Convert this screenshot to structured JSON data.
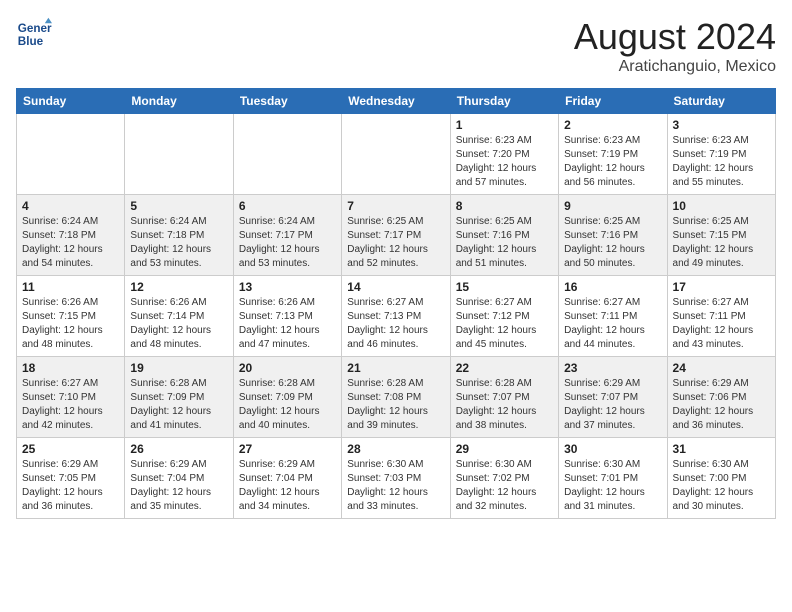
{
  "header": {
    "logo_line1": "General",
    "logo_line2": "Blue",
    "month_year": "August 2024",
    "location": "Aratichanguio, Mexico"
  },
  "weekdays": [
    "Sunday",
    "Monday",
    "Tuesday",
    "Wednesday",
    "Thursday",
    "Friday",
    "Saturday"
  ],
  "weeks": [
    [
      {
        "day": "",
        "info": ""
      },
      {
        "day": "",
        "info": ""
      },
      {
        "day": "",
        "info": ""
      },
      {
        "day": "",
        "info": ""
      },
      {
        "day": "1",
        "info": "Sunrise: 6:23 AM\nSunset: 7:20 PM\nDaylight: 12 hours\nand 57 minutes."
      },
      {
        "day": "2",
        "info": "Sunrise: 6:23 AM\nSunset: 7:19 PM\nDaylight: 12 hours\nand 56 minutes."
      },
      {
        "day": "3",
        "info": "Sunrise: 6:23 AM\nSunset: 7:19 PM\nDaylight: 12 hours\nand 55 minutes."
      }
    ],
    [
      {
        "day": "4",
        "info": "Sunrise: 6:24 AM\nSunset: 7:18 PM\nDaylight: 12 hours\nand 54 minutes."
      },
      {
        "day": "5",
        "info": "Sunrise: 6:24 AM\nSunset: 7:18 PM\nDaylight: 12 hours\nand 53 minutes."
      },
      {
        "day": "6",
        "info": "Sunrise: 6:24 AM\nSunset: 7:17 PM\nDaylight: 12 hours\nand 53 minutes."
      },
      {
        "day": "7",
        "info": "Sunrise: 6:25 AM\nSunset: 7:17 PM\nDaylight: 12 hours\nand 52 minutes."
      },
      {
        "day": "8",
        "info": "Sunrise: 6:25 AM\nSunset: 7:16 PM\nDaylight: 12 hours\nand 51 minutes."
      },
      {
        "day": "9",
        "info": "Sunrise: 6:25 AM\nSunset: 7:16 PM\nDaylight: 12 hours\nand 50 minutes."
      },
      {
        "day": "10",
        "info": "Sunrise: 6:25 AM\nSunset: 7:15 PM\nDaylight: 12 hours\nand 49 minutes."
      }
    ],
    [
      {
        "day": "11",
        "info": "Sunrise: 6:26 AM\nSunset: 7:15 PM\nDaylight: 12 hours\nand 48 minutes."
      },
      {
        "day": "12",
        "info": "Sunrise: 6:26 AM\nSunset: 7:14 PM\nDaylight: 12 hours\nand 48 minutes."
      },
      {
        "day": "13",
        "info": "Sunrise: 6:26 AM\nSunset: 7:13 PM\nDaylight: 12 hours\nand 47 minutes."
      },
      {
        "day": "14",
        "info": "Sunrise: 6:27 AM\nSunset: 7:13 PM\nDaylight: 12 hours\nand 46 minutes."
      },
      {
        "day": "15",
        "info": "Sunrise: 6:27 AM\nSunset: 7:12 PM\nDaylight: 12 hours\nand 45 minutes."
      },
      {
        "day": "16",
        "info": "Sunrise: 6:27 AM\nSunset: 7:11 PM\nDaylight: 12 hours\nand 44 minutes."
      },
      {
        "day": "17",
        "info": "Sunrise: 6:27 AM\nSunset: 7:11 PM\nDaylight: 12 hours\nand 43 minutes."
      }
    ],
    [
      {
        "day": "18",
        "info": "Sunrise: 6:27 AM\nSunset: 7:10 PM\nDaylight: 12 hours\nand 42 minutes."
      },
      {
        "day": "19",
        "info": "Sunrise: 6:28 AM\nSunset: 7:09 PM\nDaylight: 12 hours\nand 41 minutes."
      },
      {
        "day": "20",
        "info": "Sunrise: 6:28 AM\nSunset: 7:09 PM\nDaylight: 12 hours\nand 40 minutes."
      },
      {
        "day": "21",
        "info": "Sunrise: 6:28 AM\nSunset: 7:08 PM\nDaylight: 12 hours\nand 39 minutes."
      },
      {
        "day": "22",
        "info": "Sunrise: 6:28 AM\nSunset: 7:07 PM\nDaylight: 12 hours\nand 38 minutes."
      },
      {
        "day": "23",
        "info": "Sunrise: 6:29 AM\nSunset: 7:07 PM\nDaylight: 12 hours\nand 37 minutes."
      },
      {
        "day": "24",
        "info": "Sunrise: 6:29 AM\nSunset: 7:06 PM\nDaylight: 12 hours\nand 36 minutes."
      }
    ],
    [
      {
        "day": "25",
        "info": "Sunrise: 6:29 AM\nSunset: 7:05 PM\nDaylight: 12 hours\nand 36 minutes."
      },
      {
        "day": "26",
        "info": "Sunrise: 6:29 AM\nSunset: 7:04 PM\nDaylight: 12 hours\nand 35 minutes."
      },
      {
        "day": "27",
        "info": "Sunrise: 6:29 AM\nSunset: 7:04 PM\nDaylight: 12 hours\nand 34 minutes."
      },
      {
        "day": "28",
        "info": "Sunrise: 6:30 AM\nSunset: 7:03 PM\nDaylight: 12 hours\nand 33 minutes."
      },
      {
        "day": "29",
        "info": "Sunrise: 6:30 AM\nSunset: 7:02 PM\nDaylight: 12 hours\nand 32 minutes."
      },
      {
        "day": "30",
        "info": "Sunrise: 6:30 AM\nSunset: 7:01 PM\nDaylight: 12 hours\nand 31 minutes."
      },
      {
        "day": "31",
        "info": "Sunrise: 6:30 AM\nSunset: 7:00 PM\nDaylight: 12 hours\nand 30 minutes."
      }
    ]
  ]
}
